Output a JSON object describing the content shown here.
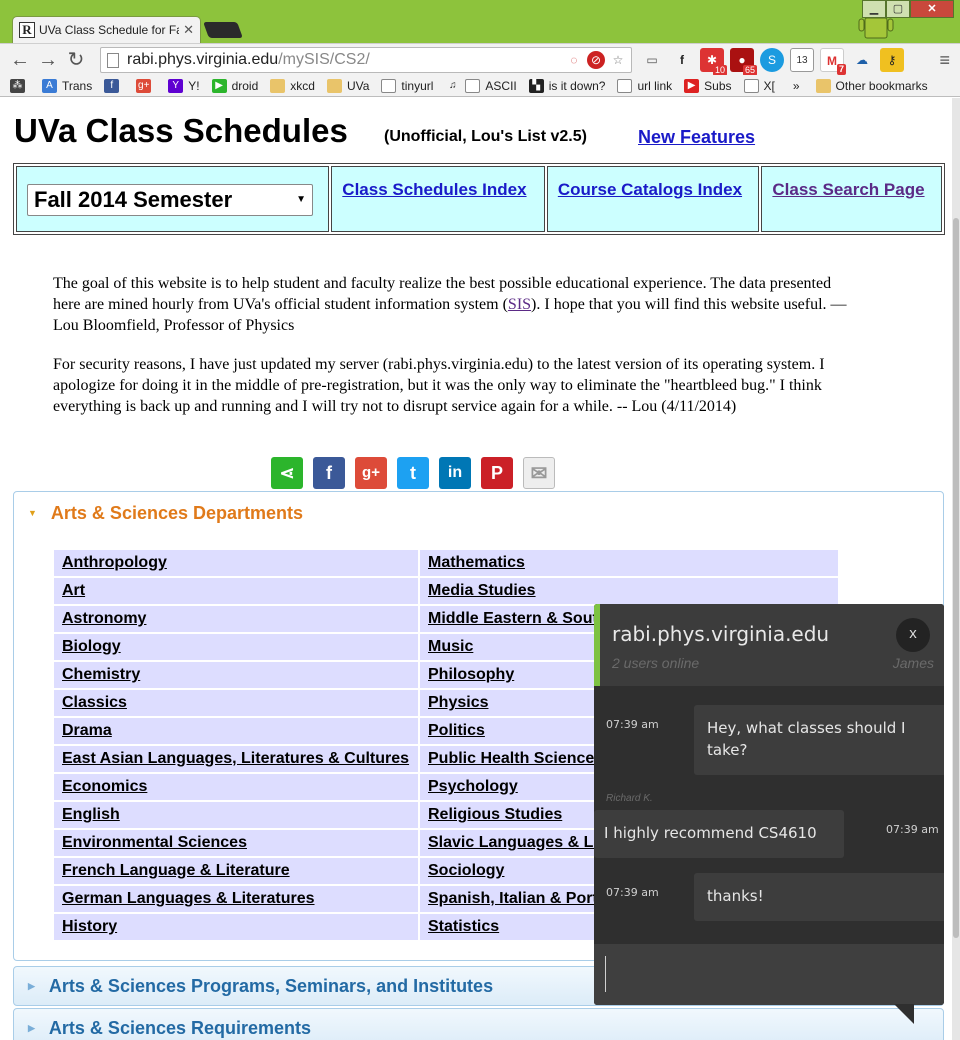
{
  "browser": {
    "tab_title": "UVa Class Schedule for Fall",
    "tab_favicon": "R",
    "url_host": "rabi.phys.virginia.edu",
    "url_path": "/mySIS/CS2/",
    "ext_badges": [
      "10",
      "65",
      "13",
      "7"
    ],
    "bookmarks": [
      "Trans",
      "Y!",
      "droid",
      "xkcd",
      "UVa",
      "tinyurl",
      "ASCII",
      "is it down?",
      "url link",
      "Subs",
      "X["
    ],
    "bookmarks_overflow": "»",
    "other_bookmarks": "Other bookmarks"
  },
  "header": {
    "title": "UVa Class Schedules",
    "subtitle": "(Unofficial, Lou's List v2.5)",
    "new_features": "New Features"
  },
  "nav": {
    "semester": "Fall 2014 Semester",
    "class_schedules_index": "Class Schedules Index",
    "course_catalogs_index": "Course Catalogs Index",
    "class_search_page": "Class Search Page"
  },
  "intro": {
    "p1_before": "The goal of this website is to help student and faculty realize the best possible educational experience. The data presented here are mined hourly from UVa's official student information system (",
    "p1_link": "SIS",
    "p1_after": "). I hope that you will find this website useful. — Lou Bloomfield, Professor of Physics",
    "p2": "For security reasons, I have just updated my server (rabi.phys.virginia.edu) to the latest version of its operating system. I apologize for doing it in the middle of pre-registration, but it was the only way to eliminate the \"heartbleed bug.\" I think everything is back up and running and I will try not to disrupt service again for a while. -- Lou (4/11/2014)"
  },
  "share": {
    "icons": [
      "share-icon",
      "facebook-icon",
      "google-plus-icon",
      "twitter-icon",
      "linkedin-icon",
      "pinterest-icon",
      "email-icon"
    ],
    "colors": [
      "#2cb52c",
      "#3b5998",
      "#dd4b39",
      "#1da1f2",
      "#0077b5",
      "#cb2027",
      "#e9e9e9"
    ]
  },
  "accordions": {
    "arts_sciences_departments": "Arts & Sciences Departments",
    "programs": "Arts & Sciences Programs, Seminars, and Institutes",
    "requirements": "Arts & Sciences Requirements"
  },
  "departments_left": [
    "Anthropology",
    "Art",
    "Astronomy",
    "Biology",
    "Chemistry",
    "Classics",
    "Drama",
    "East Asian Languages, Literatures & Cultures",
    "Economics",
    "English",
    "Environmental Sciences",
    "French Language & Literature",
    "German Languages & Literatures",
    "History"
  ],
  "departments_right": [
    "Mathematics",
    "Media Studies",
    "Middle Eastern & South Asian Languages & Cultures",
    "Music",
    "Philosophy",
    "Physics",
    "Politics",
    "Public Health Sciences",
    "Psychology",
    "Religious Studies",
    "Slavic Languages & Literatures",
    "Sociology",
    "Spanish, Italian & Portuguese",
    "Statistics"
  ],
  "chat": {
    "host": "rabi.phys.virginia.edu",
    "online": "2 users online",
    "user": "James",
    "close": "x",
    "messages": [
      {
        "time": "07:39 am",
        "text": "Hey, what classes should I take?"
      },
      {
        "sender": "Richard K.",
        "time": "07:39 am",
        "text": "I highly recommend CS4610"
      },
      {
        "time": "07:39 am",
        "text": "thanks!"
      }
    ]
  },
  "colors": {
    "chrome_green": "#8dc33c",
    "nav_cell": "#ccffff",
    "dept_cell": "#ddddff",
    "accordion_active": "#e07a1a",
    "accordion_inactive": "#236aa4",
    "chat_bg": "#2f2f2f",
    "chat_accent": "#7dc242"
  }
}
